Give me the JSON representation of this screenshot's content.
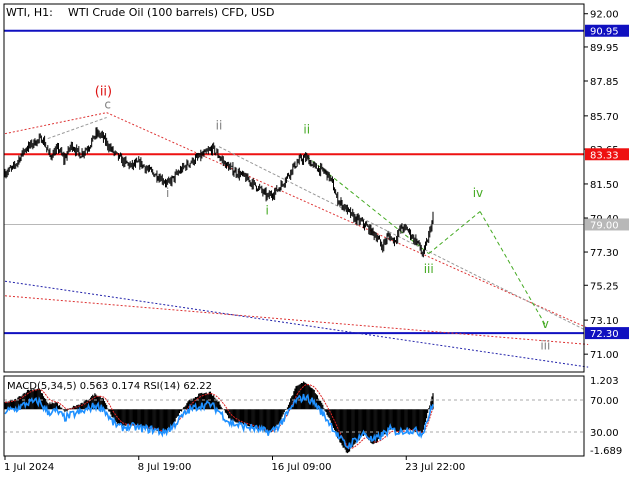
{
  "header": {
    "symbol": "WTI, H1:",
    "description": "WTI Crude Oil (100 barrels) CFD, USD"
  },
  "price_axis": {
    "ticks": [
      92.0,
      89.95,
      87.85,
      85.7,
      83.65,
      81.5,
      79.4,
      77.3,
      75.25,
      73.1,
      71.0
    ],
    "tick_labels": [
      "92.00",
      "89.95",
      "87.85",
      "85.70",
      "83.65",
      "81.50",
      "79.40",
      "77.30",
      "75.25",
      "73.10",
      "71.00"
    ],
    "range": [
      69.9,
      92.6
    ]
  },
  "levels": [
    {
      "value": 90.95,
      "label": "90.95",
      "color": "#1010c0",
      "kind": "blue"
    },
    {
      "value": 83.33,
      "label": "83.33",
      "color": "#ee1111",
      "kind": "red"
    },
    {
      "value": 79.0,
      "label": "79.00",
      "color": "#b8b8b8",
      "kind": "gray"
    },
    {
      "value": 72.3,
      "label": "72.30",
      "color": "#1010c0",
      "kind": "blue"
    }
  ],
  "wave_labels": [
    {
      "text": "(ii)",
      "color": "#dd1111",
      "bar": 92,
      "price": 86.95
    },
    {
      "text": "c",
      "color": "#808080",
      "bar": 96,
      "price": 86.15
    },
    {
      "text": "ii",
      "color": "#808080",
      "bar": 200,
      "price": 84.85
    },
    {
      "text": "i",
      "color": "#808080",
      "bar": 152,
      "price": 80.7
    },
    {
      "text": "ii",
      "color": "#44aa22",
      "bar": 282,
      "price": 84.6
    },
    {
      "text": "i",
      "color": "#44aa22",
      "bar": 245,
      "price": 79.6
    },
    {
      "text": "iv",
      "color": "#44aa22",
      "bar": 442,
      "price": 80.7
    },
    {
      "text": "iii",
      "color": "#44aa22",
      "bar": 396,
      "price": 76.0
    },
    {
      "text": "v",
      "color": "#44aa22",
      "bar": 505,
      "price": 72.6
    },
    {
      "text": "iii",
      "color": "#808080",
      "bar": 505,
      "price": 71.3
    }
  ],
  "price_series": {
    "bars": 400,
    "anchors": [
      [
        0,
        82.2
      ],
      [
        8,
        82.5
      ],
      [
        18,
        83.6
      ],
      [
        28,
        84.1
      ],
      [
        35,
        84.3
      ],
      [
        42,
        83.2
      ],
      [
        50,
        83.7
      ],
      [
        55,
        83.0
      ],
      [
        62,
        83.9
      ],
      [
        70,
        83.3
      ],
      [
        78,
        83.8
      ],
      [
        85,
        84.6
      ],
      [
        90,
        84.5
      ],
      [
        96,
        83.9
      ],
      [
        102,
        83.4
      ],
      [
        110,
        82.9
      ],
      [
        118,
        82.6
      ],
      [
        126,
        82.8
      ],
      [
        135,
        82.3
      ],
      [
        145,
        81.9
      ],
      [
        152,
        81.5
      ],
      [
        158,
        81.9
      ],
      [
        165,
        82.4
      ],
      [
        172,
        82.8
      ],
      [
        180,
        83.1
      ],
      [
        188,
        83.4
      ],
      [
        194,
        83.7
      ],
      [
        200,
        83.2
      ],
      [
        206,
        82.7
      ],
      [
        214,
        82.3
      ],
      [
        222,
        82.0
      ],
      [
        230,
        81.6
      ],
      [
        238,
        81.2
      ],
      [
        245,
        80.7
      ],
      [
        252,
        81.0
      ],
      [
        258,
        81.4
      ],
      [
        264,
        82.0
      ],
      [
        270,
        82.6
      ],
      [
        276,
        83.0
      ],
      [
        282,
        83.1
      ],
      [
        288,
        82.6
      ],
      [
        294,
        82.4
      ],
      [
        300,
        82.2
      ],
      [
        305,
        81.7
      ],
      [
        310,
        80.6
      ],
      [
        318,
        80.0
      ],
      [
        326,
        79.4
      ],
      [
        334,
        79.1
      ],
      [
        342,
        78.6
      ],
      [
        348,
        78.2
      ],
      [
        352,
        77.6
      ],
      [
        358,
        78.3
      ],
      [
        364,
        78.0
      ],
      [
        370,
        78.8
      ],
      [
        376,
        78.7
      ],
      [
        382,
        78.1
      ],
      [
        386,
        77.9
      ],
      [
        390,
        77.1
      ],
      [
        394,
        77.8
      ],
      [
        397,
        78.6
      ],
      [
        400,
        79.4
      ]
    ]
  },
  "macd": {
    "label": "MACD(5,34,5) 0.563 0.174 RSI(14) 62.22",
    "range": [
      -1.689,
      1.203
    ],
    "axis_labels": [
      "1.203",
      "70.00",
      "30.00",
      "-1.689"
    ],
    "rsi_levels": [
      70,
      30
    ],
    "anchors": [
      [
        0,
        0.25
      ],
      [
        10,
        0.35
      ],
      [
        22,
        0.7
      ],
      [
        32,
        0.75
      ],
      [
        40,
        0.2
      ],
      [
        48,
        0.25
      ],
      [
        56,
        -0.1
      ],
      [
        64,
        0.1
      ],
      [
        72,
        0.2
      ],
      [
        84,
        0.55
      ],
      [
        92,
        0.4
      ],
      [
        100,
        -0.3
      ],
      [
        108,
        -0.6
      ],
      [
        118,
        -0.55
      ],
      [
        128,
        -0.65
      ],
      [
        138,
        -0.7
      ],
      [
        148,
        -0.85
      ],
      [
        156,
        -0.6
      ],
      [
        164,
        -0.1
      ],
      [
        172,
        0.3
      ],
      [
        182,
        0.55
      ],
      [
        192,
        0.6
      ],
      [
        200,
        0.25
      ],
      [
        210,
        -0.35
      ],
      [
        220,
        -0.5
      ],
      [
        230,
        -0.6
      ],
      [
        240,
        -0.75
      ],
      [
        248,
        -0.85
      ],
      [
        256,
        -0.5
      ],
      [
        264,
        0.1
      ],
      [
        272,
        0.8
      ],
      [
        280,
        1.0
      ],
      [
        288,
        0.75
      ],
      [
        296,
        0.2
      ],
      [
        304,
        -0.4
      ],
      [
        312,
        -1.1
      ],
      [
        320,
        -1.6
      ],
      [
        328,
        -1.2
      ],
      [
        336,
        -0.9
      ],
      [
        344,
        -1.3
      ],
      [
        352,
        -1.0
      ],
      [
        360,
        -0.7
      ],
      [
        368,
        -0.85
      ],
      [
        376,
        -0.7
      ],
      [
        384,
        -0.8
      ],
      [
        390,
        -0.9
      ],
      [
        394,
        -0.3
      ],
      [
        398,
        0.3
      ],
      [
        400,
        0.56
      ]
    ]
  },
  "time_axis": {
    "labels": [
      {
        "text": "1 Jul 2024",
        "bar": 0
      },
      {
        "text": "8 Jul 19:00",
        "bar": 125
      },
      {
        "text": "16 Jul 09:00",
        "bar": 250
      },
      {
        "text": "23 Jul 22:00",
        "bar": 375
      }
    ]
  }
}
